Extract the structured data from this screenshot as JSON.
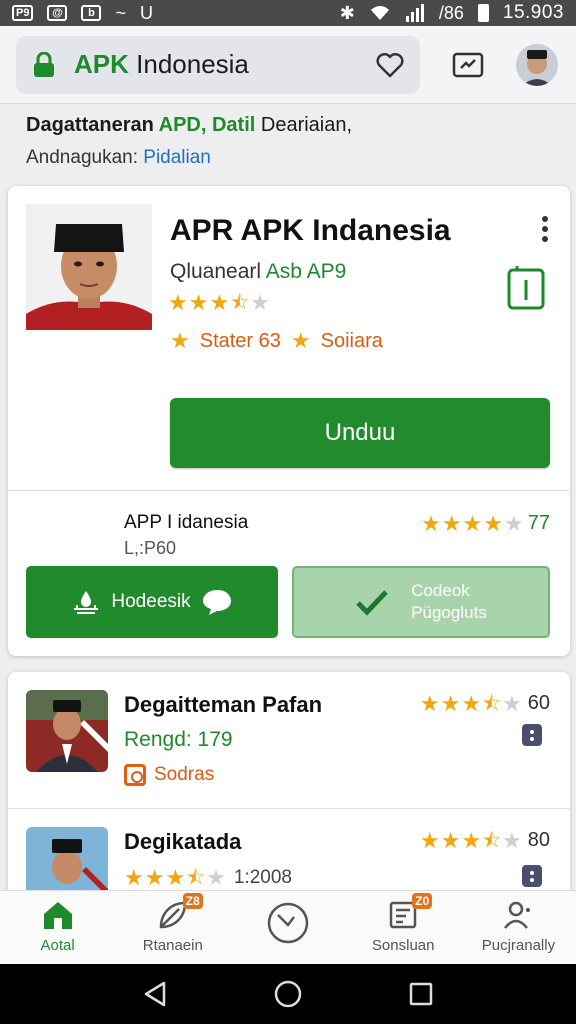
{
  "status_bar": {
    "left_icons": [
      "P9",
      "@",
      "b",
      "~",
      "U"
    ],
    "signal_text": "/86",
    "time": "15.903"
  },
  "top_bar": {
    "url_highlight": "APK",
    "url_rest": " Indonesia",
    "icons": [
      "lock-icon",
      "heart-icon",
      "share-icon",
      "avatar"
    ]
  },
  "breadcrumb": {
    "line1_prefix": "Dagattaneran ",
    "line1_green": "APD, Datil",
    "line1_rest": " Deariaian,",
    "line2_prefix": "Andnagukan: ",
    "line2_link": "Pidalian"
  },
  "main_app": {
    "title": "APR APK Indanesia",
    "sub_prefix": "Qluanearl ",
    "sub_green": "Asb AP9",
    "rating": 3.5,
    "badge1": "Stater 63",
    "badge2": "Soiiara",
    "install_label": "Unduu",
    "colors": {
      "accent": "#228b2e",
      "badge": "#d85c14",
      "star": "#f2a711"
    }
  },
  "secondary": {
    "name": "APP I idanesia",
    "size": "L,:P60",
    "rating": 4,
    "rating_value": "77",
    "left_button": "Hodeesik",
    "right_button_line1": "Codeok",
    "right_button_line2": "Pügogluts"
  },
  "list": [
    {
      "title": "Degaitteman Pafan",
      "subtitle": "Rengd: 179",
      "tag": "Sodras",
      "rating": 3.5,
      "rating_value": "60"
    },
    {
      "title": "Degikatada",
      "rating": 3.5,
      "inline_rating_text": "1:2008",
      "rating_value": "80"
    }
  ],
  "bottom_nav": [
    {
      "label": "Aotal",
      "icon": "home-icon",
      "badge": ""
    },
    {
      "label": "Rtanaein",
      "icon": "leaf-icon",
      "badge": "Z8"
    },
    {
      "label": "",
      "icon": "clock-icon",
      "badge": ""
    },
    {
      "label": "Sonsluan",
      "icon": "document-icon",
      "badge": "Z0"
    },
    {
      "label": "Pucjranally",
      "icon": "person-icon",
      "badge": ""
    }
  ]
}
